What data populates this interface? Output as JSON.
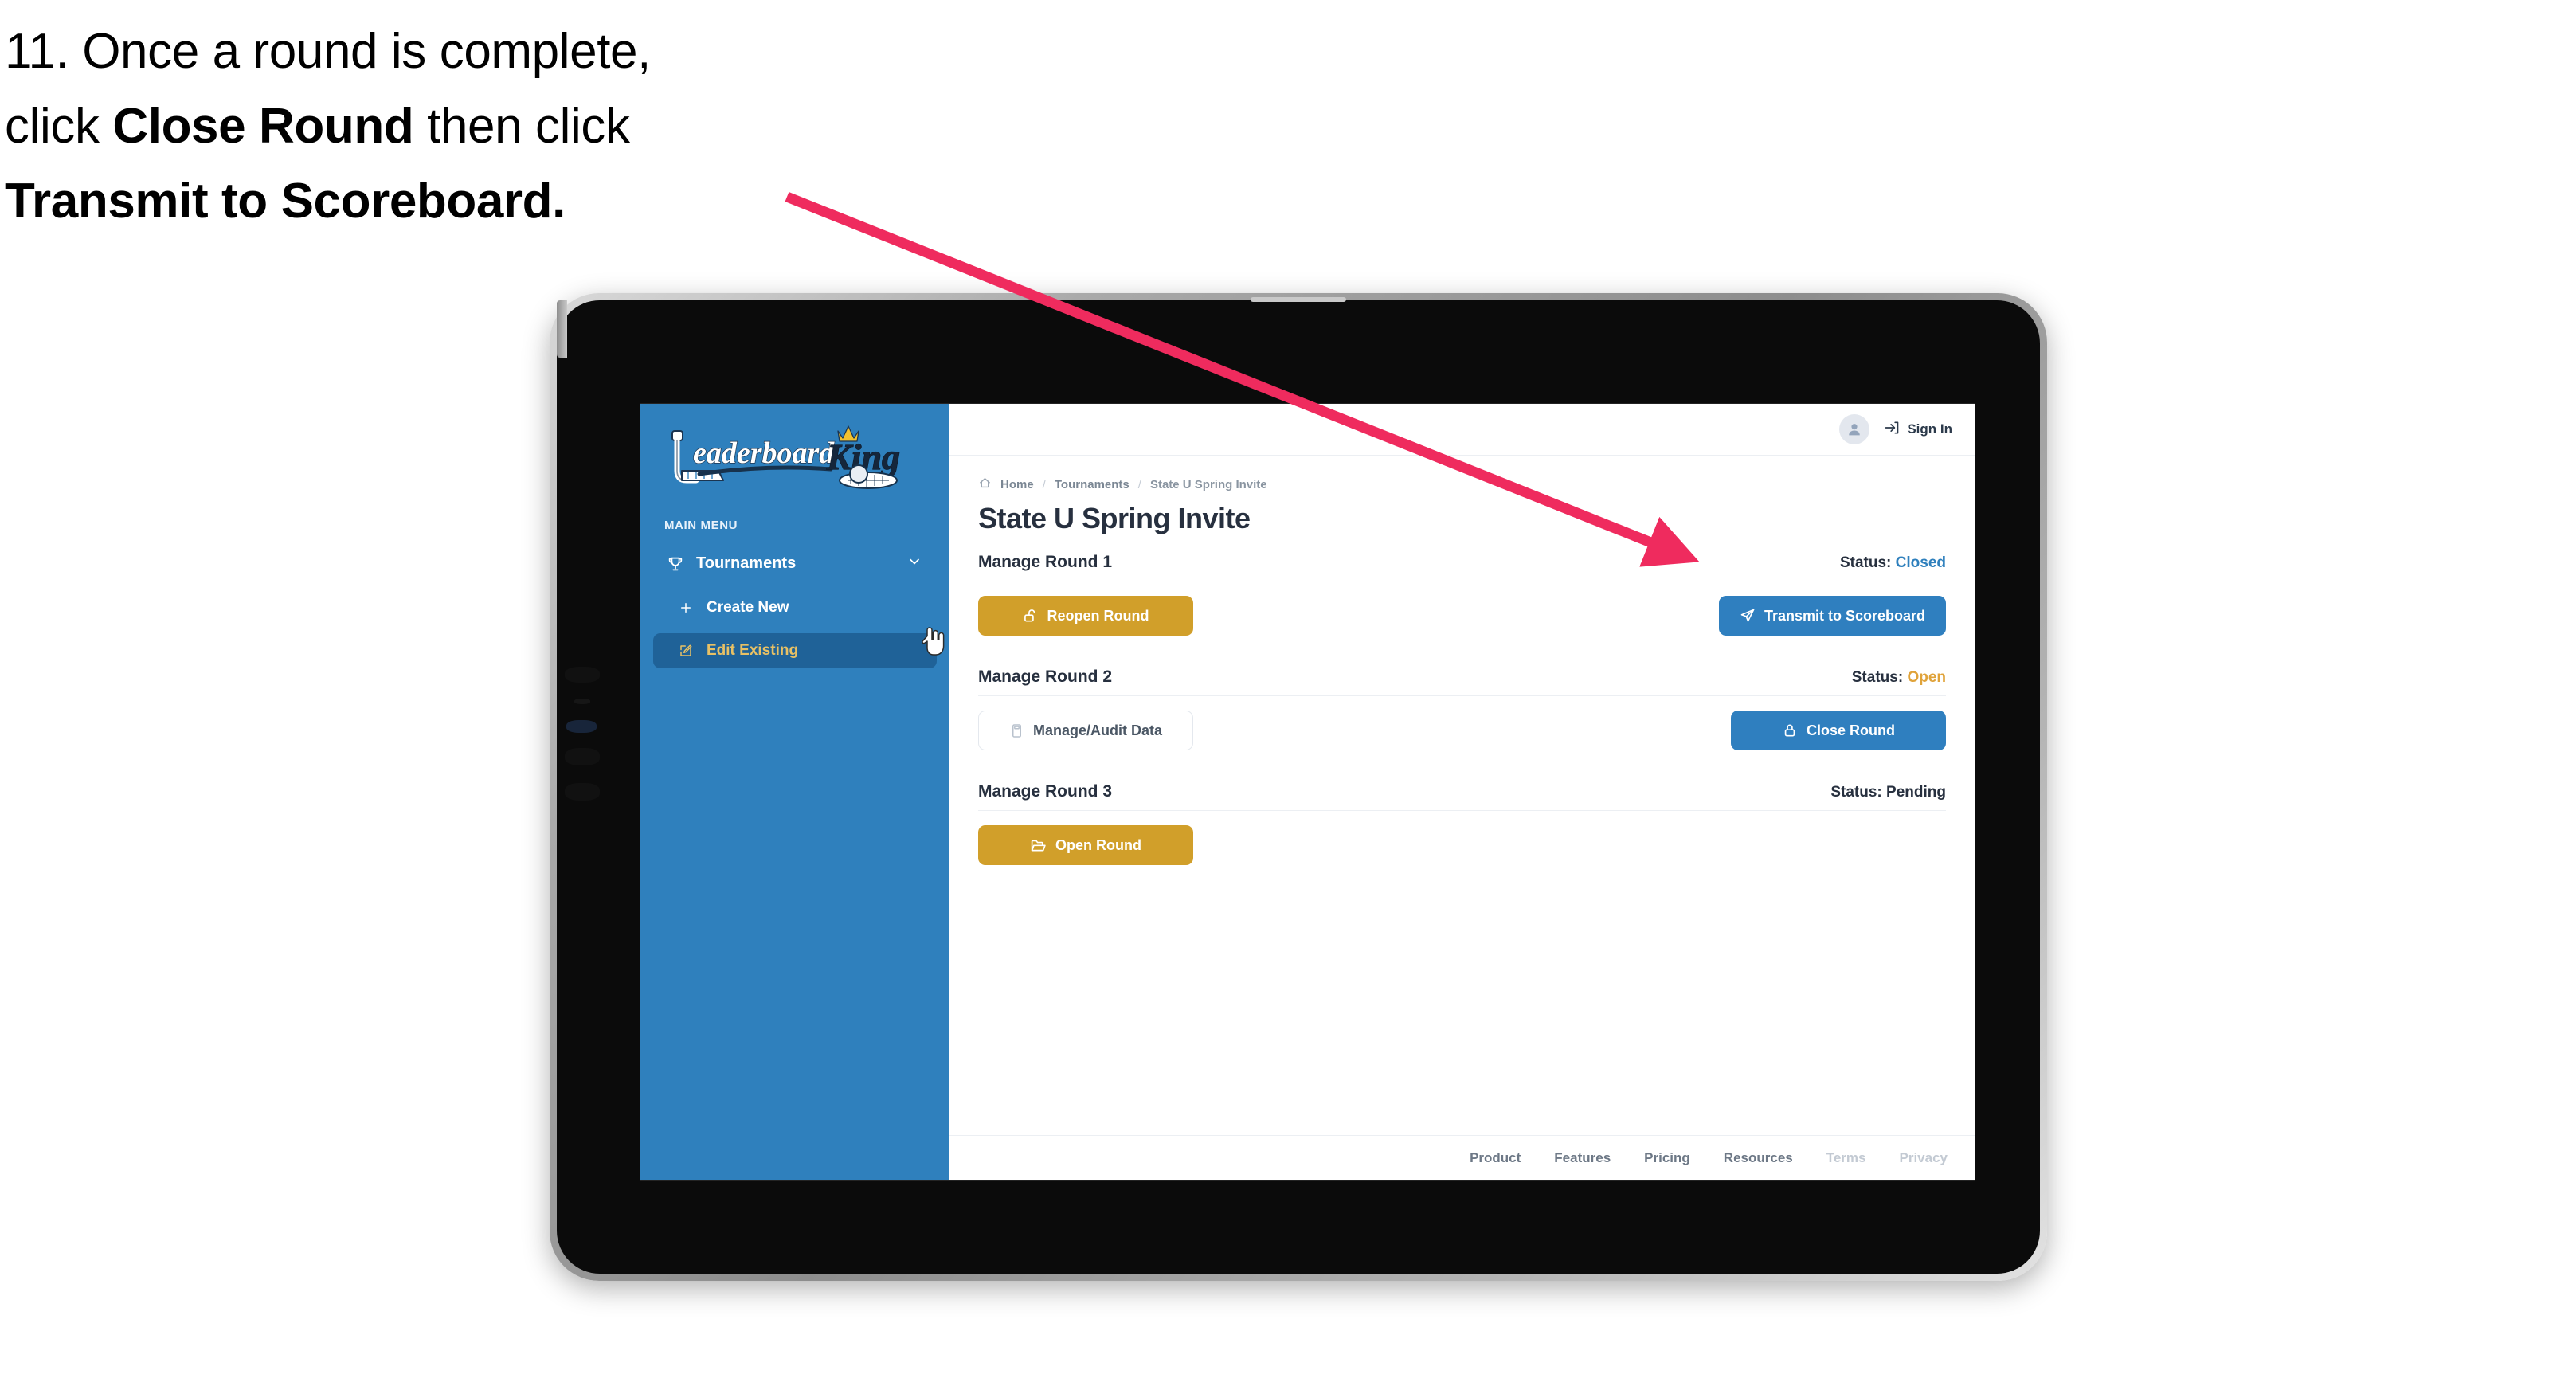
{
  "caption": {
    "line1_plain": "11. Once a round is complete,",
    "line2_pre": "click ",
    "line2_bold": "Close Round",
    "line2_post": " then click",
    "line3_bold": "Transmit to Scoreboard."
  },
  "annotation": {
    "arrow_color": "#ef2b5e",
    "points_at": "transmit-to-scoreboard-button"
  },
  "sidebar": {
    "logo": {
      "word_one": "Leaderboard",
      "word_two": "King",
      "icons": [
        "golf-putter-icon",
        "crown-icon",
        "golf-ball-on-green-icon"
      ]
    },
    "section_label": "MAIN MENU",
    "items": [
      {
        "label": "Tournaments",
        "icon": "trophy-icon",
        "expand_icon": "chevron-down-icon",
        "active": false
      },
      {
        "label": "Create New",
        "icon": "plus-icon",
        "active": false
      },
      {
        "label": "Edit Existing",
        "icon": "pencil-square-icon",
        "active": true
      }
    ],
    "bg_color": "#2f80bd",
    "active_bg_color": "#1f6298",
    "active_text_color": "#e8c165"
  },
  "topbar": {
    "avatar_icon": "user-avatar-icon",
    "signin_icon": "sign-in-arrow-icon",
    "signin_label": "Sign In"
  },
  "breadcrumb": {
    "home_icon": "home-icon",
    "items": [
      "Home",
      "Tournaments",
      "State U Spring Invite"
    ],
    "separator": "/"
  },
  "page": {
    "title": "State U Spring Invite"
  },
  "rounds": [
    {
      "title": "Manage Round 1",
      "status_label": "Status:",
      "status_value": "Closed",
      "status_class": "val-closed",
      "left_button": {
        "label": "Reopen Round",
        "icon": "unlock-icon",
        "style": "btn-gold"
      },
      "right_button": {
        "label": "Transmit to Scoreboard",
        "icon": "paper-plane-icon",
        "style": "btn-blue"
      }
    },
    {
      "title": "Manage Round 2",
      "status_label": "Status:",
      "status_value": "Open",
      "status_class": "val-open",
      "left_button": {
        "label": "Manage/Audit Data",
        "icon": "calculator-icon",
        "style": "btn-ghost"
      },
      "right_button": {
        "label": "Close Round",
        "icon": "lock-icon",
        "style": "btn-blue"
      }
    },
    {
      "title": "Manage Round 3",
      "status_label": "Status:",
      "status_value": "Pending",
      "status_class": "val-pending",
      "left_button": {
        "label": "Open Round",
        "icon": "open-folder-icon",
        "style": "btn-gold"
      },
      "right_button": null
    }
  ],
  "footer": {
    "links": [
      {
        "label": "Product",
        "dim": false
      },
      {
        "label": "Features",
        "dim": false
      },
      {
        "label": "Pricing",
        "dim": false
      },
      {
        "label": "Resources",
        "dim": false
      },
      {
        "label": "Terms",
        "dim": true
      },
      {
        "label": "Privacy",
        "dim": true
      }
    ]
  },
  "colors": {
    "brand_blue": "#2f80bd",
    "brand_gold": "#d19f2a",
    "status_open": "#e0a33a",
    "status_closed": "#2f80bd",
    "arrow_pink": "#ef2b5e",
    "device_body": "#0b0b0b"
  }
}
